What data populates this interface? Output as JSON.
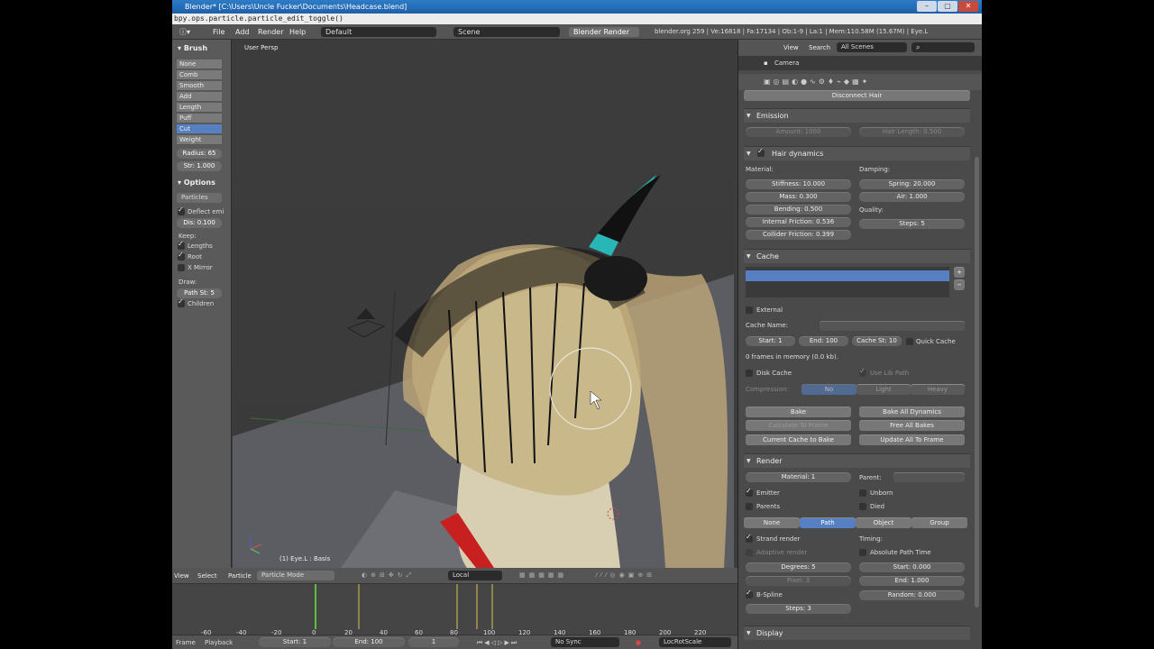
{
  "titlebar": {
    "title": "Blender* [C:\\Users\\Uncle Fucker\\Documents\\Headcase.blend]"
  },
  "infobar": {
    "text": "bpy.ops.particle.particle_edit_toggle()"
  },
  "header": {
    "menus": [
      "File",
      "Add",
      "Render",
      "Help"
    ],
    "layout": "Default",
    "scene": "Scene",
    "engine": "Blender Render",
    "stats": "blender.org 259 | Ve:16818 | Fa:17134 | Ob:1-9 | La:1 | Mem:110.58M (15.67M) | Eye.L"
  },
  "brush": {
    "title": "Brush",
    "items": [
      "None",
      "Comb",
      "Smooth",
      "Add",
      "Length",
      "Puff",
      "Cut",
      "Weight"
    ],
    "selected": 6,
    "radius": "Radius: 65",
    "strength": "Str: 1.000"
  },
  "options": {
    "title": "Options",
    "mode": "Particles",
    "deflect": "Deflect emi",
    "dist": "Dis: 0.100",
    "keep": "Keep:",
    "lengths": "Lengths",
    "root": "Root",
    "xmirror": "X Mirror",
    "draw": "Draw:",
    "path_steps": "Path St: 5",
    "children": "Children"
  },
  "viewport": {
    "label": "User Persp",
    "object": "(1) Eye.L : Basis"
  },
  "viewport_header": {
    "view": "View",
    "select": "Select",
    "particle": "Particle",
    "mode": "Particle Mode",
    "orientation": "Local"
  },
  "timeline": {
    "ticks": [
      "-60",
      "-40",
      "-20",
      "0",
      "20",
      "40",
      "60",
      "80",
      "100",
      "120",
      "140",
      "160",
      "180",
      "200",
      "220"
    ],
    "frame": "Frame",
    "playback": "Playback",
    "start": "Start: 1",
    "end": "End: 100",
    "current": "1",
    "sync": "No Sync",
    "keying": "LocRotScale"
  },
  "props_header": {
    "view": "View",
    "search": "Search",
    "scenes": "All Scenes",
    "camera": "Camera"
  },
  "props": {
    "disconnect": "Disconnect Hair",
    "emission": {
      "title": "Emission",
      "amount": "Amount: 1000",
      "hair_length": "Hair Length: 0.500"
    },
    "hair": {
      "title": "Hair dynamics",
      "material": "Material:",
      "damping": "Damping:",
      "stiffness": "Stiffness: 10.000",
      "spring": "Spring: 20.000",
      "mass": "Mass: 0.300",
      "air": "Air: 1.000",
      "bending": "Bending: 0.500",
      "quality": "Quality:",
      "internal": "Internal Friction: 0.536",
      "steps": "Steps: 5",
      "collider": "Collider Friction: 0.399"
    },
    "cache": {
      "title": "Cache",
      "external": "External",
      "cache_name": "Cache Name:",
      "start": "Start: 1",
      "end": "End: 100",
      "cache_step": "Cache St: 10",
      "quick": "Quick Cache",
      "frames": "0 frames in memory (0.0 kb).",
      "disk": "Disk Cache",
      "use_lib": "Use Lib Path",
      "compression": "Compression:",
      "no": "No",
      "light": "Light",
      "heavy": "Heavy",
      "bake": "Bake",
      "bake_all": "Bake All Dynamics",
      "calc": "Calculate To Frame",
      "free_all": "Free All Bakes",
      "current_to_bake": "Current Cache to Bake",
      "update_all": "Update All To Frame"
    },
    "render": {
      "title": "Render",
      "material": "Material: 1",
      "parent": "Parent:",
      "emitter": "Emitter",
      "unborn": "Unborn",
      "parents": "Parents",
      "died": "Died",
      "modes": [
        "None",
        "Path",
        "Object",
        "Group"
      ],
      "mode_selected": 1,
      "strand": "Strand render",
      "timing": "Timing:",
      "adaptive": "Adaptive render",
      "absolute": "Absolute Path Time",
      "degrees": "Degrees: 5",
      "start": "Start: 0.000",
      "pixel": "Pixel: 3",
      "end": "End: 1.000",
      "bspline": "B-Spline",
      "random": "Random: 0.000",
      "steps": "Steps: 3"
    },
    "display": {
      "title": "Display"
    }
  }
}
